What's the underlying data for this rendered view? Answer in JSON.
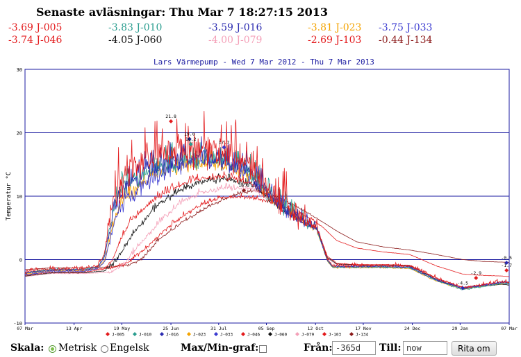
{
  "header": {
    "title": "Senaste avläsningar: Thu Mar 7 18:27:15 2013",
    "readings": [
      {
        "id": "J-005",
        "value": "-3.69 J-005",
        "color": "#e31a1c"
      },
      {
        "id": "J-010",
        "value": "-3.83 J-010",
        "color": "#2a9d8f"
      },
      {
        "id": "J-016",
        "value": "-3.59 J-016",
        "color": "#2b2bb0"
      },
      {
        "id": "J-023",
        "value": "-3.81 J-023",
        "color": "#f4a300"
      },
      {
        "id": "J-033",
        "value": "-3.75 J-033",
        "color": "#3a3ad0"
      },
      {
        "id": "J-046",
        "value": "-3.74 J-046",
        "color": "#e31a1c"
      },
      {
        "id": "J-060",
        "value": "-4.05 J-060",
        "color": "#111111"
      },
      {
        "id": "J-079",
        "value": "-4.00 J-079",
        "color": "#f4a0b8"
      },
      {
        "id": "J-103",
        "value": "-2.69 J-103",
        "color": "#e31a1c"
      },
      {
        "id": "J-134",
        "value": "-0.44 J-134",
        "color": "#8b1a1a"
      }
    ]
  },
  "chart_data": {
    "type": "line",
    "title": "Lars Värmepump - Wed  7 Mar 2012 - Thu  7 Mar 2013",
    "ylabel": "Temperatur °C",
    "xlabel": "",
    "ylim": [
      -10,
      30
    ],
    "xlim": [
      0,
      365
    ],
    "yticks": [
      -10,
      0,
      10,
      20,
      30
    ],
    "gridlines_y": [
      0,
      10,
      20
    ],
    "xticks": [
      {
        "day": 0,
        "label": "07 Mar"
      },
      {
        "day": 37,
        "label": "13 Apr"
      },
      {
        "day": 73,
        "label": "19 May"
      },
      {
        "day": 110,
        "label": "25 Jun"
      },
      {
        "day": 146,
        "label": "31 Jul"
      },
      {
        "day": 182,
        "label": "05 Sep"
      },
      {
        "day": 219,
        "label": "12 Oct"
      },
      {
        "day": 255,
        "label": "17 Nov"
      },
      {
        "day": 292,
        "label": "24 Dec"
      },
      {
        "day": 328,
        "label": "29 Jan"
      },
      {
        "day": 365,
        "label": "07 Mar"
      }
    ],
    "annotations": [
      {
        "day": 110,
        "value": 21.8,
        "label": "21.8",
        "color": "#e31a1c"
      },
      {
        "day": 124,
        "value": 19.0,
        "label": "19.0",
        "color": "#2b2bb0"
      },
      {
        "day": 125,
        "value": 18.2,
        "label": "18.2",
        "color": "#2a9d8f"
      },
      {
        "day": 150,
        "value": 17.7,
        "label": "17.7",
        "color": "#3a3ad0"
      },
      {
        "day": 165,
        "value": 10.9,
        "label": "10.9",
        "color": "#8b1a1a"
      },
      {
        "day": 340,
        "value": -2.9,
        "label": "-2.9",
        "color": "#e31a1c"
      },
      {
        "day": 363,
        "value": -1.7,
        "label": "-1.7",
        "color": "#e31a1c"
      },
      {
        "day": 363,
        "value": -0.5,
        "label": "-0.5",
        "color": "#2b2bb0"
      },
      {
        "day": 330,
        "value": -4.5,
        "label": "-4.5",
        "color": "#2b2bb0"
      }
    ],
    "series": [
      {
        "name": "J-005",
        "color": "#e31a1c",
        "noise": 3.0,
        "points": [
          [
            0,
            -2
          ],
          [
            20,
            -1.5
          ],
          [
            45,
            -1.5
          ],
          [
            55,
            -1
          ],
          [
            60,
            1
          ],
          [
            63,
            5
          ],
          [
            68,
            10
          ],
          [
            75,
            13
          ],
          [
            90,
            15
          ],
          [
            110,
            16.5
          ],
          [
            130,
            17
          ],
          [
            150,
            16.5
          ],
          [
            170,
            14
          ],
          [
            180,
            11
          ],
          [
            195,
            8
          ],
          [
            210,
            6
          ],
          [
            220,
            5
          ],
          [
            228,
            0
          ],
          [
            232,
            -1
          ],
          [
            245,
            -1
          ],
          [
            270,
            -1
          ],
          [
            290,
            -1
          ],
          [
            310,
            -3
          ],
          [
            330,
            -4.5
          ],
          [
            345,
            -4
          ],
          [
            360,
            -3.5
          ],
          [
            365,
            -3.7
          ]
        ]
      },
      {
        "name": "J-010",
        "color": "#2a9d8f",
        "noise": 1.6,
        "points": [
          [
            0,
            -2.1
          ],
          [
            20,
            -1.6
          ],
          [
            45,
            -1.6
          ],
          [
            55,
            -1.1
          ],
          [
            60,
            0.5
          ],
          [
            63,
            4
          ],
          [
            68,
            8.5
          ],
          [
            75,
            11.5
          ],
          [
            90,
            13.5
          ],
          [
            110,
            15
          ],
          [
            130,
            15.7
          ],
          [
            150,
            15.3
          ],
          [
            170,
            13.3
          ],
          [
            180,
            10.8
          ],
          [
            195,
            7.8
          ],
          [
            210,
            5.8
          ],
          [
            220,
            4.7
          ],
          [
            228,
            -0.2
          ],
          [
            232,
            -1.2
          ],
          [
            245,
            -1.2
          ],
          [
            270,
            -1.2
          ],
          [
            290,
            -1.3
          ],
          [
            310,
            -3.3
          ],
          [
            330,
            -4.8
          ],
          [
            345,
            -4.3
          ],
          [
            360,
            -3.8
          ],
          [
            365,
            -3.8
          ]
        ]
      },
      {
        "name": "J-016",
        "color": "#2b2bb0",
        "noise": 1.6,
        "points": [
          [
            0,
            -2.2
          ],
          [
            20,
            -1.7
          ],
          [
            45,
            -1.7
          ],
          [
            55,
            -1.2
          ],
          [
            60,
            0.3
          ],
          [
            63,
            3.5
          ],
          [
            68,
            8
          ],
          [
            75,
            11
          ],
          [
            90,
            13.5
          ],
          [
            110,
            15.2
          ],
          [
            130,
            16
          ],
          [
            150,
            15.5
          ],
          [
            170,
            13.4
          ],
          [
            180,
            10.9
          ],
          [
            195,
            7.9
          ],
          [
            210,
            5.9
          ],
          [
            220,
            4.8
          ],
          [
            228,
            -0.1
          ],
          [
            232,
            -1.1
          ],
          [
            245,
            -1.1
          ],
          [
            270,
            -1.1
          ],
          [
            290,
            -1.2
          ],
          [
            310,
            -3.2
          ],
          [
            330,
            -4.6
          ],
          [
            345,
            -4.1
          ],
          [
            360,
            -3.6
          ],
          [
            365,
            -3.6
          ]
        ]
      },
      {
        "name": "J-023",
        "color": "#f4a300",
        "noise": 1.2,
        "points": [
          [
            0,
            -2.3
          ],
          [
            20,
            -1.8
          ],
          [
            45,
            -1.8
          ],
          [
            55,
            -1.3
          ],
          [
            60,
            -0.2
          ],
          [
            63,
            2.5
          ],
          [
            68,
            6.5
          ],
          [
            75,
            9.5
          ],
          [
            90,
            12
          ],
          [
            110,
            14
          ],
          [
            130,
            15
          ],
          [
            150,
            14.8
          ],
          [
            170,
            13
          ],
          [
            180,
            10.7
          ],
          [
            195,
            7.7
          ],
          [
            210,
            5.7
          ],
          [
            220,
            4.6
          ],
          [
            228,
            -0.3
          ],
          [
            232,
            -1.3
          ],
          [
            245,
            -1.3
          ],
          [
            270,
            -1.3
          ],
          [
            290,
            -1.4
          ],
          [
            310,
            -3.4
          ],
          [
            330,
            -4.7
          ],
          [
            345,
            -4.2
          ],
          [
            360,
            -3.8
          ],
          [
            365,
            -3.8
          ]
        ]
      },
      {
        "name": "J-033",
        "color": "#3a3ad0",
        "noise": 1.3,
        "points": [
          [
            0,
            -2.4
          ],
          [
            20,
            -1.9
          ],
          [
            45,
            -1.9
          ],
          [
            55,
            -1.4
          ],
          [
            60,
            -0.4
          ],
          [
            63,
            2
          ],
          [
            68,
            6
          ],
          [
            75,
            9
          ],
          [
            90,
            11.8
          ],
          [
            110,
            14
          ],
          [
            130,
            15.2
          ],
          [
            150,
            15
          ],
          [
            170,
            13.1
          ],
          [
            180,
            10.8
          ],
          [
            195,
            7.8
          ],
          [
            210,
            5.8
          ],
          [
            220,
            4.7
          ],
          [
            228,
            -0.2
          ],
          [
            232,
            -1.2
          ],
          [
            245,
            -1.2
          ],
          [
            270,
            -1.2
          ],
          [
            290,
            -1.3
          ],
          [
            310,
            -3.3
          ],
          [
            330,
            -4.6
          ],
          [
            345,
            -4.1
          ],
          [
            360,
            -3.7
          ],
          [
            365,
            -3.75
          ]
        ]
      },
      {
        "name": "J-046",
        "color": "#e31a1c",
        "noise": 0.5,
        "points": [
          [
            0,
            -2.5
          ],
          [
            20,
            -2
          ],
          [
            45,
            -2
          ],
          [
            60,
            -1.5
          ],
          [
            66,
            0
          ],
          [
            72,
            3
          ],
          [
            80,
            6
          ],
          [
            95,
            9
          ],
          [
            110,
            11
          ],
          [
            130,
            12.6
          ],
          [
            150,
            13
          ],
          [
            170,
            12
          ],
          [
            180,
            10.5
          ],
          [
            195,
            7.8
          ],
          [
            210,
            5.8
          ],
          [
            220,
            4.9
          ],
          [
            228,
            0.5
          ],
          [
            235,
            -0.6
          ],
          [
            250,
            -0.8
          ],
          [
            270,
            -0.8
          ],
          [
            290,
            -0.9
          ],
          [
            310,
            -2.9
          ],
          [
            330,
            -4.4
          ],
          [
            345,
            -4
          ],
          [
            360,
            -3.6
          ],
          [
            365,
            -3.7
          ]
        ]
      },
      {
        "name": "J-060",
        "color": "#111111",
        "noise": 0.5,
        "points": [
          [
            0,
            -2.6
          ],
          [
            20,
            -2.1
          ],
          [
            45,
            -2.1
          ],
          [
            60,
            -1.8
          ],
          [
            68,
            -0.5
          ],
          [
            75,
            2
          ],
          [
            85,
            5
          ],
          [
            100,
            8.5
          ],
          [
            115,
            10.5
          ],
          [
            130,
            12
          ],
          [
            150,
            12.6
          ],
          [
            170,
            11.8
          ],
          [
            180,
            10.3
          ],
          [
            195,
            7.7
          ],
          [
            210,
            5.7
          ],
          [
            220,
            4.8
          ],
          [
            228,
            0.3
          ],
          [
            235,
            -0.7
          ],
          [
            250,
            -0.9
          ],
          [
            270,
            -0.9
          ],
          [
            290,
            -1
          ],
          [
            310,
            -3.1
          ],
          [
            330,
            -4.6
          ],
          [
            345,
            -4.2
          ],
          [
            360,
            -3.9
          ],
          [
            365,
            -4.05
          ]
        ]
      },
      {
        "name": "J-079",
        "color": "#f4a0b8",
        "noise": 0.4,
        "points": [
          [
            0,
            -2.7
          ],
          [
            20,
            -2.2
          ],
          [
            45,
            -2.2
          ],
          [
            65,
            -2
          ],
          [
            75,
            -0.8
          ],
          [
            85,
            2
          ],
          [
            100,
            5.5
          ],
          [
            115,
            8.5
          ],
          [
            130,
            10.3
          ],
          [
            150,
            11.2
          ],
          [
            170,
            11
          ],
          [
            180,
            10
          ],
          [
            195,
            7.6
          ],
          [
            210,
            5.6
          ],
          [
            220,
            4.7
          ],
          [
            228,
            0.2
          ],
          [
            235,
            -0.8
          ],
          [
            250,
            -1
          ],
          [
            270,
            -1
          ],
          [
            290,
            -1.1
          ],
          [
            310,
            -3.2
          ],
          [
            330,
            -4.6
          ],
          [
            345,
            -4.2
          ],
          [
            360,
            -3.9
          ],
          [
            365,
            -4
          ]
        ]
      },
      {
        "name": "J-103",
        "color": "#e31a1c",
        "noise": 0.3,
        "points": [
          [
            0,
            -2
          ],
          [
            20,
            -1.6
          ],
          [
            45,
            -1.6
          ],
          [
            65,
            -1.4
          ],
          [
            75,
            -0.8
          ],
          [
            90,
            1.5
          ],
          [
            105,
            4.5
          ],
          [
            120,
            7
          ],
          [
            135,
            8.8
          ],
          [
            150,
            9.8
          ],
          [
            170,
            9.8
          ],
          [
            185,
            9
          ],
          [
            200,
            7.8
          ],
          [
            215,
            6.5
          ],
          [
            225,
            5
          ],
          [
            235,
            3
          ],
          [
            250,
            1.8
          ],
          [
            270,
            1.2
          ],
          [
            290,
            0.8
          ],
          [
            310,
            -1
          ],
          [
            330,
            -2.3
          ],
          [
            345,
            -2.5
          ],
          [
            360,
            -2.6
          ],
          [
            365,
            -2.69
          ]
        ]
      },
      {
        "name": "J-134",
        "color": "#8b1a1a",
        "noise": 0.2,
        "points": [
          [
            0,
            -1.6
          ],
          [
            20,
            -1.3
          ],
          [
            45,
            -1.3
          ],
          [
            70,
            -1.1
          ],
          [
            80,
            -0.8
          ],
          [
            88,
            0
          ],
          [
            100,
            3
          ],
          [
            120,
            6
          ],
          [
            140,
            8.5
          ],
          [
            160,
            10.3
          ],
          [
            175,
            10.8
          ],
          [
            190,
            9.8
          ],
          [
            205,
            8.3
          ],
          [
            220,
            6.5
          ],
          [
            235,
            4.5
          ],
          [
            250,
            2.8
          ],
          [
            270,
            2
          ],
          [
            290,
            1.5
          ],
          [
            310,
            0.8
          ],
          [
            330,
            0
          ],
          [
            345,
            -0.3
          ],
          [
            360,
            -0.4
          ],
          [
            365,
            -0.44
          ]
        ]
      }
    ]
  },
  "controls": {
    "scale_label": "Skala:",
    "metric_label": "Metrisk",
    "imperial_label": "Engelsk",
    "maxmin_label": "Max/Min-graf:",
    "from_label": "Från:",
    "from_value": "-365d",
    "to_label": "Till:",
    "to_value": "now",
    "redraw_label": "Rita om"
  }
}
